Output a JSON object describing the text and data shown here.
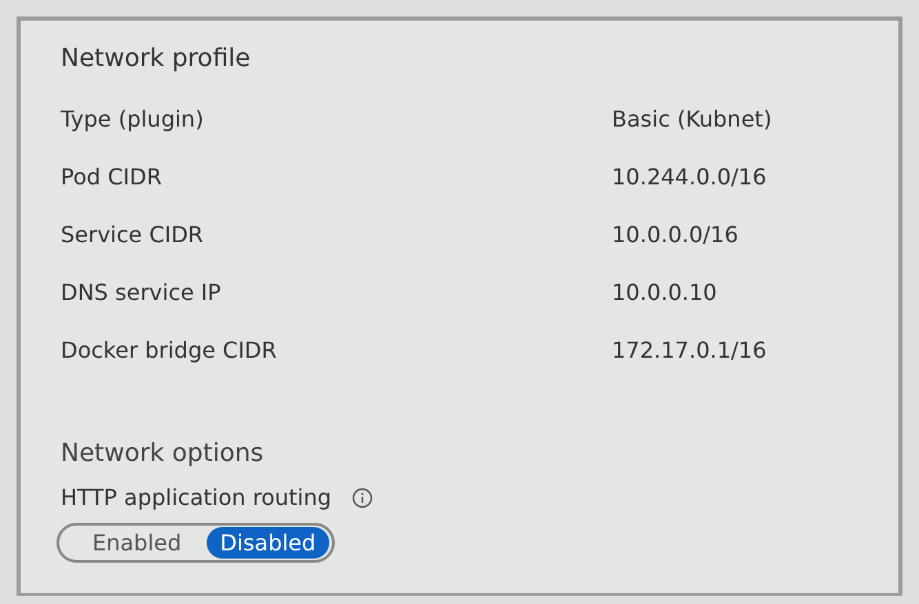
{
  "profile": {
    "title": "Network profile",
    "rows": [
      {
        "label": "Type (plugin)",
        "value": "Basic (Kubnet)"
      },
      {
        "label": "Pod CIDR",
        "value": "10.244.0.0/16"
      },
      {
        "label": "Service CIDR",
        "value": "10.0.0.0/16"
      },
      {
        "label": "DNS service IP",
        "value": "10.0.0.10"
      },
      {
        "label": "Docker bridge CIDR",
        "value": "172.17.0.1/16"
      }
    ]
  },
  "options": {
    "title": "Network options",
    "routing": {
      "label": "HTTP application routing",
      "choices": [
        {
          "label": "Enabled",
          "selected": false
        },
        {
          "label": "Disabled",
          "selected": true
        }
      ]
    }
  }
}
